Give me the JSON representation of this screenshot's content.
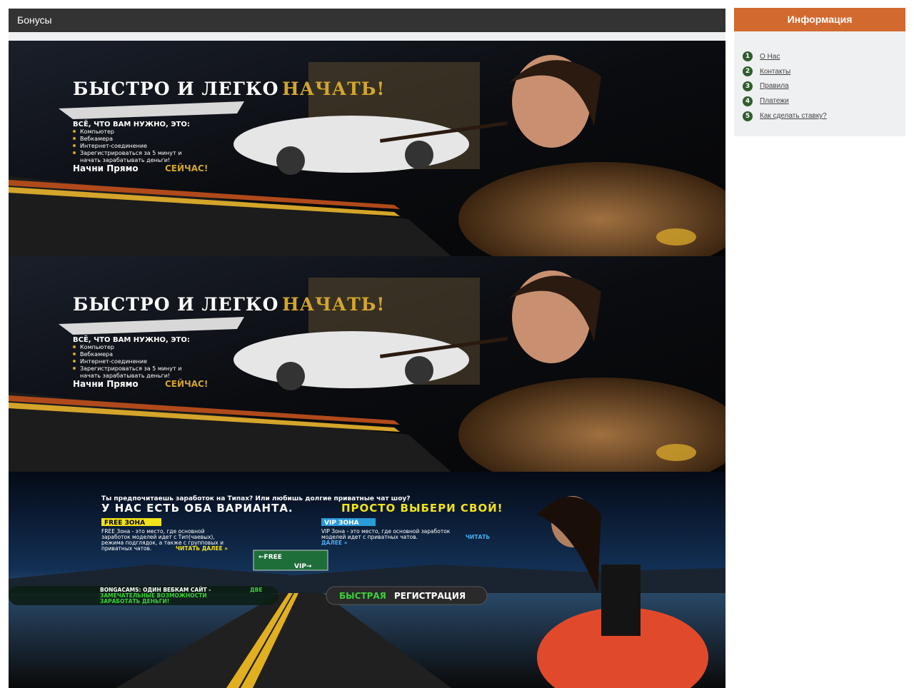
{
  "main": {
    "title": "Бонусы"
  },
  "banner_promo": {
    "headline_white": "БЫСТРО И ЛЕГКО",
    "headline_gold": "НАЧАТЬ!",
    "subtitle": "ВСЁ, ЧТО ВАМ НУЖНО, ЭТО:",
    "items": [
      "Компьютер",
      "Вебкамера",
      "Интернет-соединение",
      "Зарегистрироваться за 5 минут и",
      "начать зарабатывать деньги!"
    ],
    "cta_white": "Начни Прямо",
    "cta_gold": "СЕЙЧАС!"
  },
  "banner_zones": {
    "question": "Ты предпочитаешь заработок на Типах? Или любишь долгие приватные чат шоу?",
    "headline_white": "У НАС ЕСТЬ ОБА ВАРИАНТА.",
    "headline_yellow": "ПРОСТО ВЫБЕРИ СВОЙ!",
    "free_badge": "FREE ЗОНА",
    "free_text": [
      "FREE Зона - это место, где основной",
      "заработок моделей идет с Тип(чаевых),",
      "режима подглядок, а также с групповых и",
      "приватных чатов."
    ],
    "free_more": "ЧИТАТЬ ДАЛЕЕ »",
    "vip_badge": "VIP ЗОНА",
    "vip_text": [
      "VIP Зона - это место, где основной заработок",
      "моделей идет с приватных чатов."
    ],
    "vip_more_1": "ЧИТАТЬ",
    "vip_more_2": "ДАЛЕЕ »",
    "sign_free": "←FREE",
    "sign_vip": "VIP→",
    "bonga_white": "BONGACAMS: ОДИН ВЕБКАМ САЙТ -",
    "bonga_green_1": "ДВЕ",
    "bonga_green_2": "ЗАМЕЧАТЕЛЬНЫЕ ВОЗМОЖНОСТИ",
    "bonga_green_3": "ЗАРАБОТАТЬ ДЕНЬГИ!",
    "reg_green": "БЫСТРАЯ",
    "reg_white": "РЕГИСТРАЦИЯ"
  },
  "sidebar": {
    "title": "Информация",
    "items": [
      {
        "num": "1",
        "label": "О Нас"
      },
      {
        "num": "2",
        "label": "Контакты"
      },
      {
        "num": "3",
        "label": "Правила"
      },
      {
        "num": "4",
        "label": "Платежи"
      },
      {
        "num": "5",
        "label": "Как сделать ставку?"
      }
    ]
  },
  "colors": {
    "header_dark": "#333333",
    "sidebar_accent": "#d2692f",
    "panel_bg": "#eef0f1",
    "number_badge": "#2e5d2a",
    "gold": "#d4a52a",
    "zone_yellow": "#f2e21a",
    "zone_green": "#3ccf3a"
  }
}
